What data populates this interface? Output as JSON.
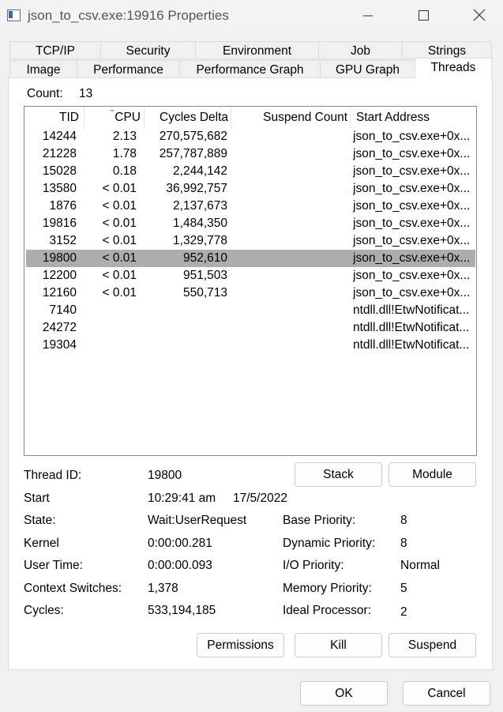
{
  "window": {
    "title": "json_to_csv.exe:19916 Properties"
  },
  "tabs": {
    "row1": [
      "TCP/IP",
      "Security",
      "Environment",
      "Job",
      "Strings"
    ],
    "row2": [
      "Image",
      "Performance",
      "Performance Graph",
      "GPU Graph",
      "Threads"
    ],
    "active": "Threads"
  },
  "count": {
    "label": "Count:",
    "value": "13"
  },
  "threads": {
    "columns": [
      "TID",
      "CPU",
      "Cycles Delta",
      "Suspend Count",
      "Start Address"
    ],
    "sorted_column": "CPU",
    "selected_row": 7,
    "rows": [
      [
        "14244",
        "2.13",
        "270,575,682",
        "",
        "json_to_csv.exe+0x..."
      ],
      [
        "21228",
        "1.78",
        "257,787,889",
        "",
        "json_to_csv.exe+0x..."
      ],
      [
        "15028",
        "0.18",
        "2,244,142",
        "",
        "json_to_csv.exe+0x..."
      ],
      [
        "13580",
        "< 0.01",
        "36,992,757",
        "",
        "json_to_csv.exe+0x..."
      ],
      [
        "1876",
        "< 0.01",
        "2,137,673",
        "",
        "json_to_csv.exe+0x..."
      ],
      [
        "19816",
        "< 0.01",
        "1,484,350",
        "",
        "json_to_csv.exe+0x..."
      ],
      [
        "3152",
        "< 0.01",
        "1,329,778",
        "",
        "json_to_csv.exe+0x..."
      ],
      [
        "19800",
        "< 0.01",
        "952,610",
        "",
        "json_to_csv.exe+0x..."
      ],
      [
        "12200",
        "< 0.01",
        "951,503",
        "",
        "json_to_csv.exe+0x..."
      ],
      [
        "12160",
        "< 0.01",
        "550,713",
        "",
        "json_to_csv.exe+0x..."
      ],
      [
        "7140",
        "",
        "",
        "",
        "ntdll.dll!EtwNotificat..."
      ],
      [
        "24272",
        "",
        "",
        "",
        "ntdll.dll!EtwNotificat..."
      ],
      [
        "19304",
        "",
        "",
        "",
        "ntdll.dll!EtwNotificat..."
      ]
    ]
  },
  "details": {
    "thread_id_label": "Thread ID:",
    "thread_id": "19800",
    "start_label": "Start",
    "start_time": "10:29:41 am",
    "start_date": "17/5/2022",
    "state_label": "State:",
    "state": "Wait:UserRequest",
    "kernel_label": "Kernel",
    "kernel": "0:00:00.281",
    "user_time_label": "User Time:",
    "user_time": "0:00:00.093",
    "context_switches_label": "Context Switches:",
    "context_switches": "1,378",
    "cycles_label": "Cycles:",
    "cycles": "533,194,185",
    "base_priority_label": "Base Priority:",
    "base_priority": "8",
    "dynamic_priority_label": "Dynamic Priority:",
    "dynamic_priority": "8",
    "io_priority_label": "I/O Priority:",
    "io_priority": "Normal",
    "memory_priority_label": "Memory Priority:",
    "memory_priority": "5",
    "ideal_processor_label": "Ideal Processor:",
    "ideal_processor": "2"
  },
  "buttons": {
    "stack": "Stack",
    "module": "Module",
    "permissions": "Permissions",
    "kill": "Kill",
    "suspend": "Suspend",
    "ok": "OK",
    "cancel": "Cancel"
  },
  "colors": {
    "selection": "#adadad",
    "list_border": "#828790"
  }
}
